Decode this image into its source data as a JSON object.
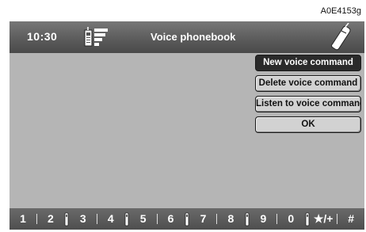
{
  "ref_code": "A0E4153g",
  "header": {
    "time": "10:30",
    "phonebook_icon": "phonebook-icon",
    "title": "Voice phonebook",
    "phone_icon": "mobile-phone-icon"
  },
  "menu": {
    "items": [
      {
        "label": "New voice command",
        "selected": true
      },
      {
        "label": "Delete voice command",
        "selected": false
      },
      {
        "label": "Listen to voice command",
        "selected": false
      },
      {
        "label": "OK",
        "selected": false
      }
    ]
  },
  "keypad": {
    "keys": [
      "1",
      "2",
      "3",
      "4",
      "5",
      "6",
      "7",
      "8",
      "9",
      "0",
      "★/+",
      "#"
    ],
    "separators": [
      "line",
      "icon",
      "line",
      "icon",
      "line",
      "icon",
      "line",
      "icon",
      "line",
      "icon",
      "line"
    ]
  },
  "colors": {
    "screen_bg": "#b5b5b5",
    "header_bg": "#5a5a5a",
    "selected_bg": "#2a2a2a",
    "button_bg": "#d2d2d2"
  }
}
